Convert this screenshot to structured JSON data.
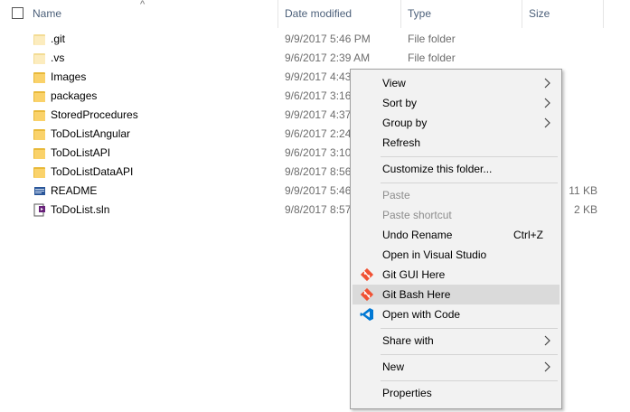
{
  "header": {
    "name": "Name",
    "date_modified": "Date modified",
    "type": "Type",
    "size": "Size"
  },
  "files": [
    {
      "name": ".git",
      "date": "9/9/2017 5:46 PM",
      "type": "File folder",
      "size": "",
      "icon": "folder-icon"
    },
    {
      "name": ".vs",
      "date": "9/6/2017 2:39 AM",
      "type": "File folder",
      "size": "",
      "icon": "folder-icon"
    },
    {
      "name": "Images",
      "date": "9/9/2017 4:43",
      "type": "",
      "size": "",
      "icon": "folder-icon"
    },
    {
      "name": "packages",
      "date": "9/6/2017 3:16",
      "type": "",
      "size": "",
      "icon": "folder-icon"
    },
    {
      "name": "StoredProcedures",
      "date": "9/9/2017 4:37",
      "type": "",
      "size": "",
      "icon": "folder-icon"
    },
    {
      "name": "ToDoListAngular",
      "date": "9/6/2017 2:24",
      "type": "",
      "size": "",
      "icon": "folder-icon"
    },
    {
      "name": "ToDoListAPI",
      "date": "9/6/2017 3:10",
      "type": "",
      "size": "",
      "icon": "folder-icon"
    },
    {
      "name": "ToDoListDataAPI",
      "date": "9/8/2017 8:56",
      "type": "",
      "size": "",
      "icon": "folder-icon"
    },
    {
      "name": "README",
      "date": "9/9/2017 5:46",
      "type": "",
      "size": "11 KB",
      "icon": "markdown-file-icon"
    },
    {
      "name": "ToDoList.sln",
      "date": "9/8/2017 8:57",
      "type": "",
      "size": "2 KB",
      "icon": "visual-studio-solution-icon"
    }
  ],
  "context_menu": {
    "view": "View",
    "sort_by": "Sort by",
    "group_by": "Group by",
    "refresh": "Refresh",
    "customize": "Customize this folder...",
    "paste": "Paste",
    "paste_shortcut": "Paste shortcut",
    "undo_rename": "Undo Rename",
    "undo_rename_shortcut": "Ctrl+Z",
    "open_vs": "Open in Visual Studio",
    "git_gui": "Git GUI Here",
    "git_bash": "Git Bash Here",
    "open_code": "Open with Code",
    "share_with": "Share with",
    "new": "New",
    "properties": "Properties"
  },
  "colors": {
    "header_text": "#4c607a",
    "secondary_text": "#6d6d6d",
    "menu_background": "#f2f2f2",
    "menu_highlight": "#dadada",
    "folder": "#fad26a"
  }
}
